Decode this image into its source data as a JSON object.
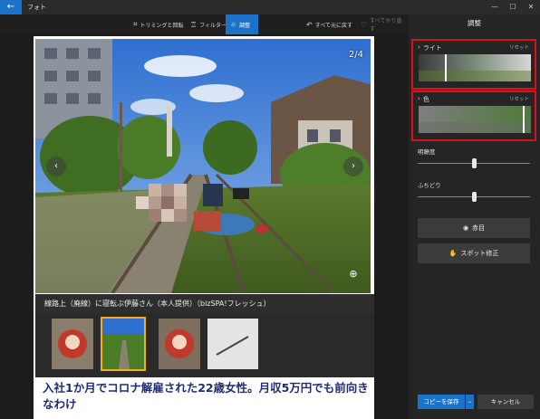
{
  "window": {
    "back_icon": "back-arrow-icon",
    "title": "フォト",
    "controls": [
      "—",
      "☐",
      "✕"
    ]
  },
  "toolbar": {
    "crop_label": "トリミングと回転",
    "filter_label": "フィルター",
    "adjust_label": "調整",
    "undo_all_label": "すべて元に戻す",
    "redo_all_label": "すべてやり直す"
  },
  "article": {
    "counter": "2/4",
    "caption": "線路上（廃線）に寝転ぶ伊藤さん（本人提供）（bizSPA!フレッシュ）",
    "headline": "入社1か月でコロナ解雇された22歳女性。月収5万円でも前向きなわけ",
    "thumbnails_count": 4,
    "selected_thumbnail": 2
  },
  "panel": {
    "title": "調整",
    "light": {
      "label": "ライト",
      "reset": "リセット",
      "level": 0.23
    },
    "color": {
      "label": "色",
      "reset": "リセット",
      "level": 0.93
    },
    "clarity": {
      "label": "明瞭度",
      "value": 0.5
    },
    "vignette": {
      "label": "ふちどり",
      "value": 0.5
    },
    "redeye_label": "赤目",
    "spot_fix_label": "スポット修正",
    "save_copy_label": "コピーを保存",
    "cancel_label": "キャンセル"
  },
  "colors": {
    "accent": "#1a73c9",
    "highlight_border": "#d8121c",
    "headline": "#1e2c78",
    "thumb_selected": "#f3b01c"
  }
}
